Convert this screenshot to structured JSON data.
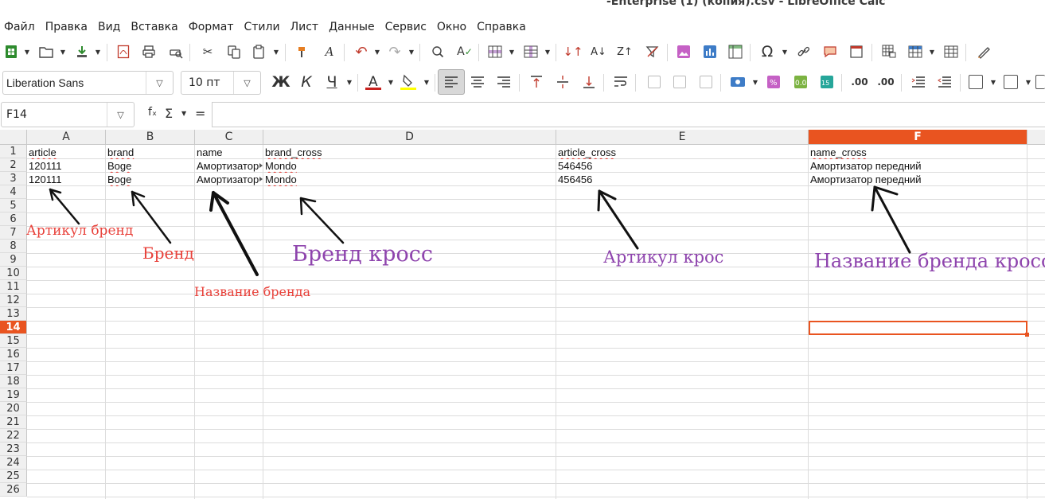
{
  "window": {
    "title": "-Enterprise (1) (копия).csv - LibreOffice Calc"
  },
  "menu": [
    "Файл",
    "Правка",
    "Вид",
    "Вставка",
    "Формат",
    "Стили",
    "Лист",
    "Данные",
    "Сервис",
    "Окно",
    "Справка"
  ],
  "font": {
    "name": "Liberation Sans",
    "size": "10 пт"
  },
  "format_buttons": {
    "bold": "Ж",
    "italic": "К",
    "underline": "Ч"
  },
  "formula_bar": {
    "cell_ref": "F14",
    "fx": "fₓ",
    "sigma": "Σ",
    "equals": "=",
    "content": ""
  },
  "columns": [
    "A",
    "B",
    "C",
    "D",
    "E",
    "F"
  ],
  "selected_column": "F",
  "rows": [
    "1",
    "2",
    "3",
    "4",
    "5",
    "6",
    "7",
    "8",
    "9",
    "10",
    "11",
    "12",
    "13",
    "14",
    "15",
    "16",
    "17",
    "18",
    "19",
    "20",
    "21",
    "22",
    "23",
    "24",
    "25",
    "26"
  ],
  "selected_row": "14",
  "cells": {
    "header": [
      "article",
      "brand",
      "name",
      "brand_cross",
      "article_cross",
      "name_cross"
    ],
    "row2": [
      "120111",
      "Boge",
      "Амортизатор",
      "Mondo",
      "546456",
      "Амортизатор передний"
    ],
    "row3": [
      "120111",
      "Boge",
      "Амортизатор",
      "Mondo",
      "456456",
      "Амортизатор передний"
    ]
  },
  "annotations": [
    {
      "text": "Артикул бренд",
      "color": "#e8413a"
    },
    {
      "text": "Бренд",
      "color": "#e8413a"
    },
    {
      "text": "Название бренда",
      "color": "#e8413a"
    },
    {
      "text": "Бренд кросс",
      "color": "#8e44ad"
    },
    {
      "text": "Артикул крос",
      "color": "#8e44ad"
    },
    {
      "text": "Название бренда кросс",
      "color": "#8e44ad"
    }
  ],
  "colors": {
    "accent": "#e95420"
  }
}
